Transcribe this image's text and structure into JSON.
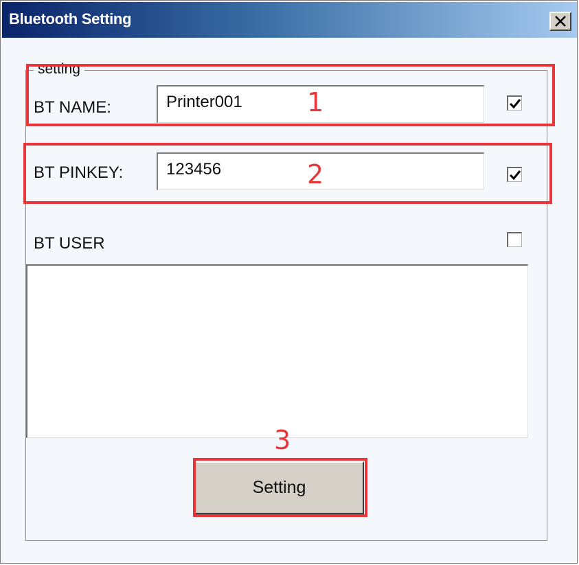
{
  "window": {
    "title": "Bluetooth Setting",
    "close_glyph": "✕"
  },
  "group": {
    "legend": "setting"
  },
  "fields": {
    "bt_name": {
      "label": "BT NAME:",
      "value": "Printer001",
      "checked": true
    },
    "bt_pinkey": {
      "label": "BT PINKEY:",
      "value": "123456",
      "checked": true
    },
    "bt_user": {
      "label": "BT USER",
      "checked": false
    }
  },
  "button": {
    "label": "Setting"
  },
  "annotations": {
    "one": "1",
    "two": "2",
    "three": "3",
    "color": "#e8373a"
  }
}
